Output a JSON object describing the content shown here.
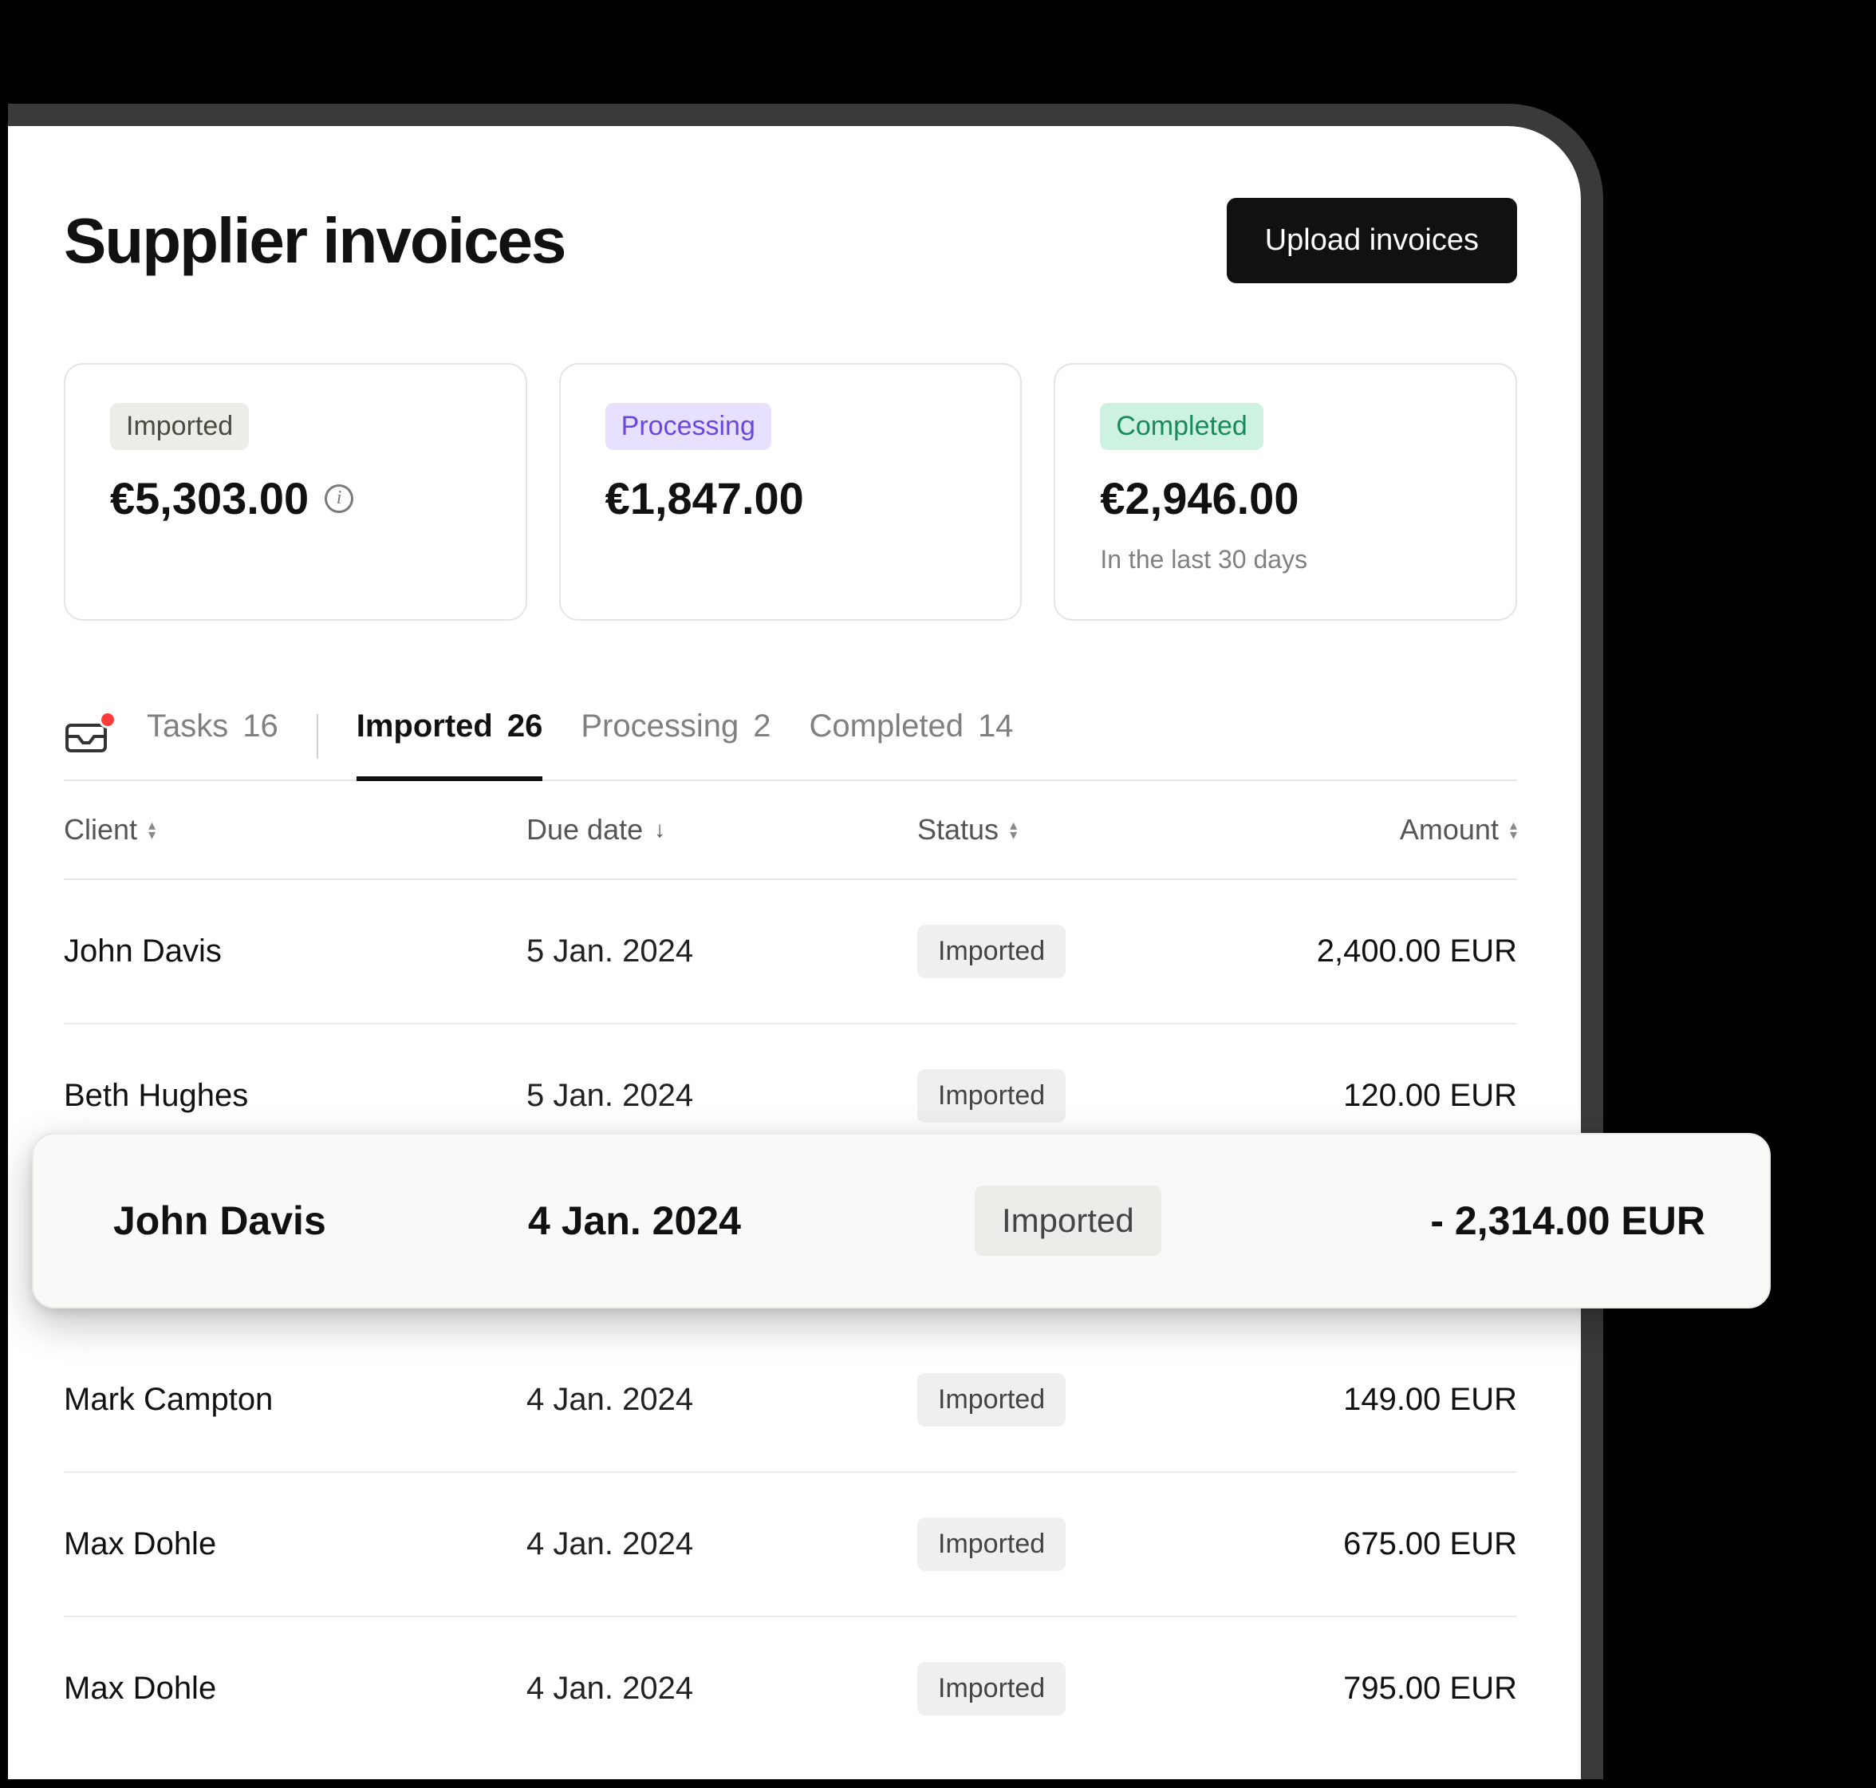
{
  "header": {
    "title": "Supplier invoices",
    "upload_button": "Upload invoices"
  },
  "summary_cards": {
    "imported": {
      "badge": "Imported",
      "amount": "€5,303.00"
    },
    "processing": {
      "badge": "Processing",
      "amount": "€1,847.00"
    },
    "completed": {
      "badge": "Completed",
      "amount": "€2,946.00",
      "subtext": "In the last 30 days"
    }
  },
  "tabs": {
    "tasks": {
      "label": "Tasks",
      "count": "16"
    },
    "imported": {
      "label": "Imported",
      "count": "26"
    },
    "processing": {
      "label": "Processing",
      "count": "2"
    },
    "completed": {
      "label": "Completed",
      "count": "14"
    }
  },
  "columns": {
    "client": "Client",
    "due_date": "Due date",
    "status": "Status",
    "amount": "Amount"
  },
  "rows": [
    {
      "client": "John Davis",
      "due_date": "5 Jan. 2024",
      "status": "Imported",
      "amount": "2,400.00 EUR"
    },
    {
      "client": "Beth Hughes",
      "due_date": "5 Jan. 2024",
      "status": "Imported",
      "amount": "120.00 EUR"
    },
    {
      "client": "Mark Campton",
      "due_date": "4 Jan. 2024",
      "status": "Imported",
      "amount": "149.00 EUR"
    },
    {
      "client": "Max Dohle",
      "due_date": "4 Jan. 2024",
      "status": "Imported",
      "amount": "675.00 EUR"
    },
    {
      "client": "Max Dohle",
      "due_date": "4 Jan. 2024",
      "status": "Imported",
      "amount": "795.00 EUR"
    }
  ],
  "highlighted_row": {
    "client": "John Davis",
    "due_date": "4 Jan. 2024",
    "status": "Imported",
    "amount": "- 2,314.00 EUR"
  }
}
